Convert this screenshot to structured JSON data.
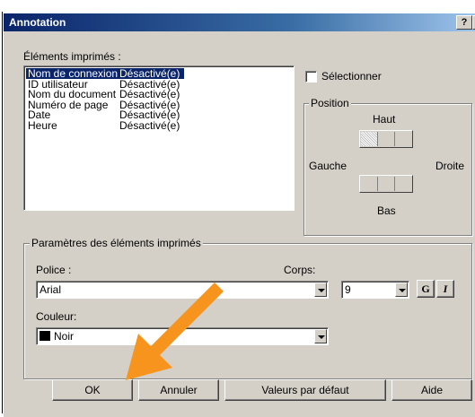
{
  "dialog": {
    "title": "Annotation",
    "help_glyph": "?",
    "close_glyph": "×"
  },
  "printed_items": {
    "label": "Éléments imprimés :",
    "rows": [
      {
        "name": "Nom de connexion",
        "state": "Désactivé(e)",
        "selected": true
      },
      {
        "name": "ID utilisateur",
        "state": "Désactivé(e)",
        "selected": false
      },
      {
        "name": "Nom du document",
        "state": "Désactivé(e)",
        "selected": false
      },
      {
        "name": "Numéro de page",
        "state": "Désactivé(e)",
        "selected": false
      },
      {
        "name": "Date",
        "state": "Désactivé(e)",
        "selected": false
      },
      {
        "name": "Heure",
        "state": "Désactivé(e)",
        "selected": false
      }
    ]
  },
  "select_checkbox": {
    "label": "Sélectionner",
    "checked": false
  },
  "position": {
    "label": "Position",
    "top": "Haut",
    "bottom": "Bas",
    "left": "Gauche",
    "right": "Droite"
  },
  "params": {
    "label": "Paramètres des éléments imprimés",
    "font_label": "Police :",
    "font_value": "Arial",
    "size_label": "Corps:",
    "size_value": "9",
    "bold_label": "G",
    "italic_label": "I",
    "color_label": "Couleur:",
    "color_value": "Noir",
    "color_swatch": "#000000"
  },
  "buttons": {
    "ok": "OK",
    "cancel": "Annuler",
    "defaults": "Valeurs par défaut",
    "help": "Aide"
  },
  "annotation_arrow": {
    "color": "#f7941d",
    "icon": "arrow-pointing-to-ok"
  }
}
